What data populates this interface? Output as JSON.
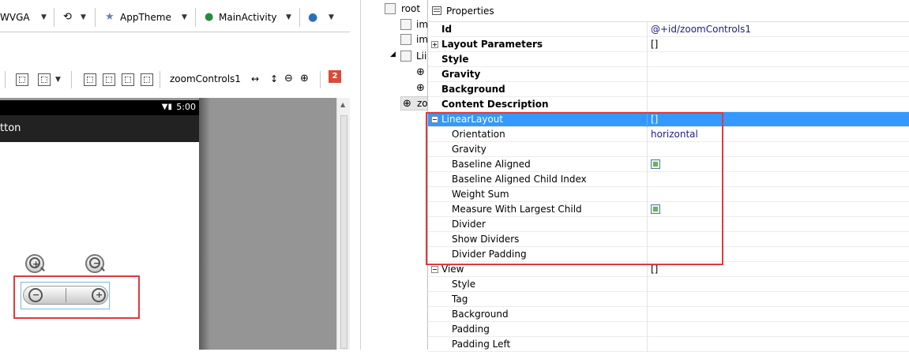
{
  "toolbar1": {
    "device": "WVGA",
    "theme": "AppTheme",
    "activity": "MainActivity"
  },
  "toolbar2": {
    "widget_name": "zoomControls1",
    "warnings_badge": "2"
  },
  "device": {
    "time": "5:00",
    "action_bar_title": "tton"
  },
  "outline": {
    "root_label": "root",
    "items": [
      "im",
      "im",
      "Lii",
      "zo"
    ]
  },
  "properties": {
    "title": "Properties",
    "rows": [
      {
        "name": "Id",
        "value": "@+id/zoomControls1"
      },
      {
        "name": "Layout Parameters",
        "value": "[]"
      },
      {
        "name": "Style",
        "value": ""
      },
      {
        "name": "Gravity",
        "value": ""
      },
      {
        "name": "Background",
        "value": ""
      },
      {
        "name": "Content Description",
        "value": ""
      },
      {
        "name": "LinearLayout",
        "value": "[]"
      },
      {
        "name": "Orientation",
        "value": "horizontal"
      },
      {
        "name": "Gravity",
        "value": ""
      },
      {
        "name": "Baseline Aligned",
        "value": ""
      },
      {
        "name": "Baseline Aligned Child Index",
        "value": ""
      },
      {
        "name": "Weight Sum",
        "value": ""
      },
      {
        "name": "Measure With Largest Child",
        "value": ""
      },
      {
        "name": "Divider",
        "value": ""
      },
      {
        "name": "Show Dividers",
        "value": ""
      },
      {
        "name": "Divider Padding",
        "value": ""
      },
      {
        "name": "View",
        "value": "[]"
      },
      {
        "name": "Style",
        "value": ""
      },
      {
        "name": "Tag",
        "value": ""
      },
      {
        "name": "Background",
        "value": ""
      },
      {
        "name": "Padding",
        "value": ""
      },
      {
        "name": "Padding Left",
        "value": ""
      }
    ]
  },
  "colors": {
    "selection": "#3399ff",
    "highlight_box": "#e0393e",
    "canvas": "#959595"
  }
}
